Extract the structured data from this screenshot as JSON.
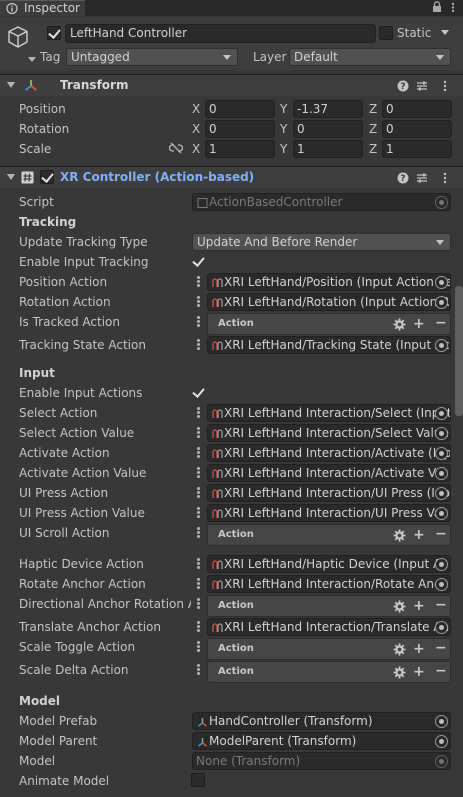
{
  "tab": {
    "label": "Inspector"
  },
  "header": {
    "active": true,
    "object_name": "LeftHand Controller",
    "static_label": "Static",
    "tag_label": "Tag",
    "tag_value": "Untagged",
    "layer_label": "Layer",
    "layer_value": "Default"
  },
  "transform": {
    "title": "Transform",
    "rows": [
      {
        "label": "Position",
        "x": "0",
        "y": "-1.37",
        "z": "0"
      },
      {
        "label": "Rotation",
        "x": "0",
        "y": "0",
        "z": "0"
      },
      {
        "label": "Scale",
        "x": "1",
        "y": "1",
        "z": "1"
      }
    ],
    "axis_labels": {
      "x": "X",
      "y": "Y",
      "z": "Z"
    }
  },
  "xr": {
    "title": "XR Controller (Action-based)",
    "enabled": true,
    "script_label": "Script",
    "script_value": "ActionBasedController",
    "tracking_title": "Tracking",
    "update_tracking_type_label": "Update Tracking Type",
    "update_tracking_type_value": "Update And Before Render",
    "enable_input_tracking_label": "Enable Input Tracking",
    "enable_input_tracking": true,
    "position_action_label": "Position Action",
    "position_action_value": "XRI LeftHand/Position (Input Action Re",
    "rotation_action_label": "Rotation Action",
    "rotation_action_value": "XRI LeftHand/Rotation (Input Action R",
    "is_tracked_action_label": "Is Tracked Action",
    "action_text": "Action",
    "tracking_state_action_label": "Tracking State Action",
    "tracking_state_action_value": "XRI LeftHand/Tracking State (Input Ac",
    "input_title": "Input",
    "enable_input_actions_label": "Enable Input Actions",
    "enable_input_actions": true,
    "select_action_label": "Select Action",
    "select_action_value": "XRI LeftHand Interaction/Select (Input",
    "select_action_value_label": "Select Action Value",
    "select_action_value_value": "XRI LeftHand Interaction/Select Value",
    "activate_action_label": "Activate Action",
    "activate_action_value": "XRI LeftHand Interaction/Activate (Inp",
    "activate_action_value_label": "Activate Action Value",
    "activate_action_value_value": "XRI LeftHand Interaction/Activate Val",
    "ui_press_action_label": "UI Press Action",
    "ui_press_action_value": "XRI LeftHand Interaction/UI Press (Inp",
    "ui_press_action_value_label": "UI Press Action Value",
    "ui_press_action_value_value": "XRI LeftHand Interaction/UI Press Val",
    "ui_scroll_action_label": "UI Scroll Action",
    "haptic_device_action_label": "Haptic Device Action",
    "haptic_device_action_value": "XRI LeftHand/Haptic Device (Input Ac",
    "rotate_anchor_action_label": "Rotate Anchor Action",
    "rotate_anchor_action_value": "XRI LeftHand Interaction/Rotate Anch",
    "directional_anchor_rotation_label": "Directional Anchor Rotation Ac",
    "translate_anchor_action_label": "Translate Anchor Action",
    "translate_anchor_action_value": "XRI LeftHand Interaction/Translate An",
    "scale_toggle_action_label": "Scale Toggle Action",
    "scale_delta_action_label": "Scale Delta Action",
    "model_title": "Model",
    "model_prefab_label": "Model Prefab",
    "model_prefab_value": "HandController (Transform)",
    "model_parent_label": "Model Parent",
    "model_parent_value": "ModelParent (Transform)",
    "model_label": "Model",
    "model_value": "None (Transform)",
    "animate_model_label": "Animate Model",
    "animate_model": false
  }
}
